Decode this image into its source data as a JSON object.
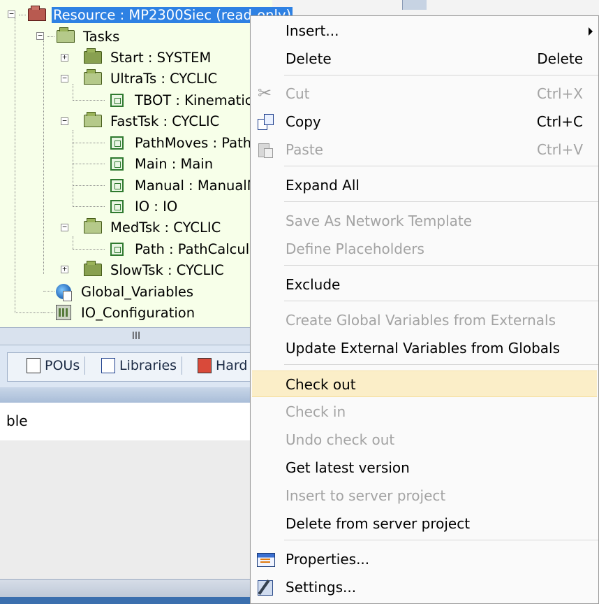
{
  "tree": {
    "resource": "Resource : MP2300Siec (read-only)",
    "tasks": "Tasks",
    "start": "Start : SYSTEM",
    "ultra": "UltraTs : CYCLIC",
    "tbot": "TBOT : Kinematic",
    "fast": "FastTsk : CYCLIC",
    "pathmoves": "PathMoves : Path",
    "main": "Main : Main",
    "manual": "Manual : ManualM",
    "io": "IO : IO",
    "med": "MedTsk : CYCLIC",
    "path": "Path : PathCalcula",
    "slow": "SlowTsk : CYCLIC",
    "globals": "Global_Variables",
    "ioconfig": "IO_Configuration"
  },
  "splitter": {
    "grip": "III"
  },
  "tabs": {
    "pous": "POUs",
    "libraries": "Libraries",
    "hardware": "Hard"
  },
  "lower": {
    "partial_text": "ble"
  },
  "menu": {
    "insert": "Insert...",
    "delete": "Delete",
    "delete_sc": "Delete",
    "cut": "Cut",
    "cut_sc": "Ctrl+X",
    "copy": "Copy",
    "copy_sc": "Ctrl+C",
    "paste": "Paste",
    "paste_sc": "Ctrl+V",
    "expand_all": "Expand All",
    "save_template": "Save As Network Template",
    "define_placeholders": "Define Placeholders",
    "exclude": "Exclude",
    "create_globals": "Create Global Variables from Externals",
    "update_externals": "Update External Variables from Globals",
    "check_out": "Check out",
    "check_in": "Check in",
    "undo_check_out": "Undo check out",
    "get_latest": "Get latest version",
    "insert_server": "Insert to server project",
    "delete_server": "Delete from server project",
    "properties": "Properties...",
    "settings": "Settings..."
  },
  "colors": {
    "selection": "#2e81e3",
    "tree_bg": "#f7ffe9",
    "menu_hover": "#fbeec8",
    "disabled_text": "#a3a3a3"
  }
}
